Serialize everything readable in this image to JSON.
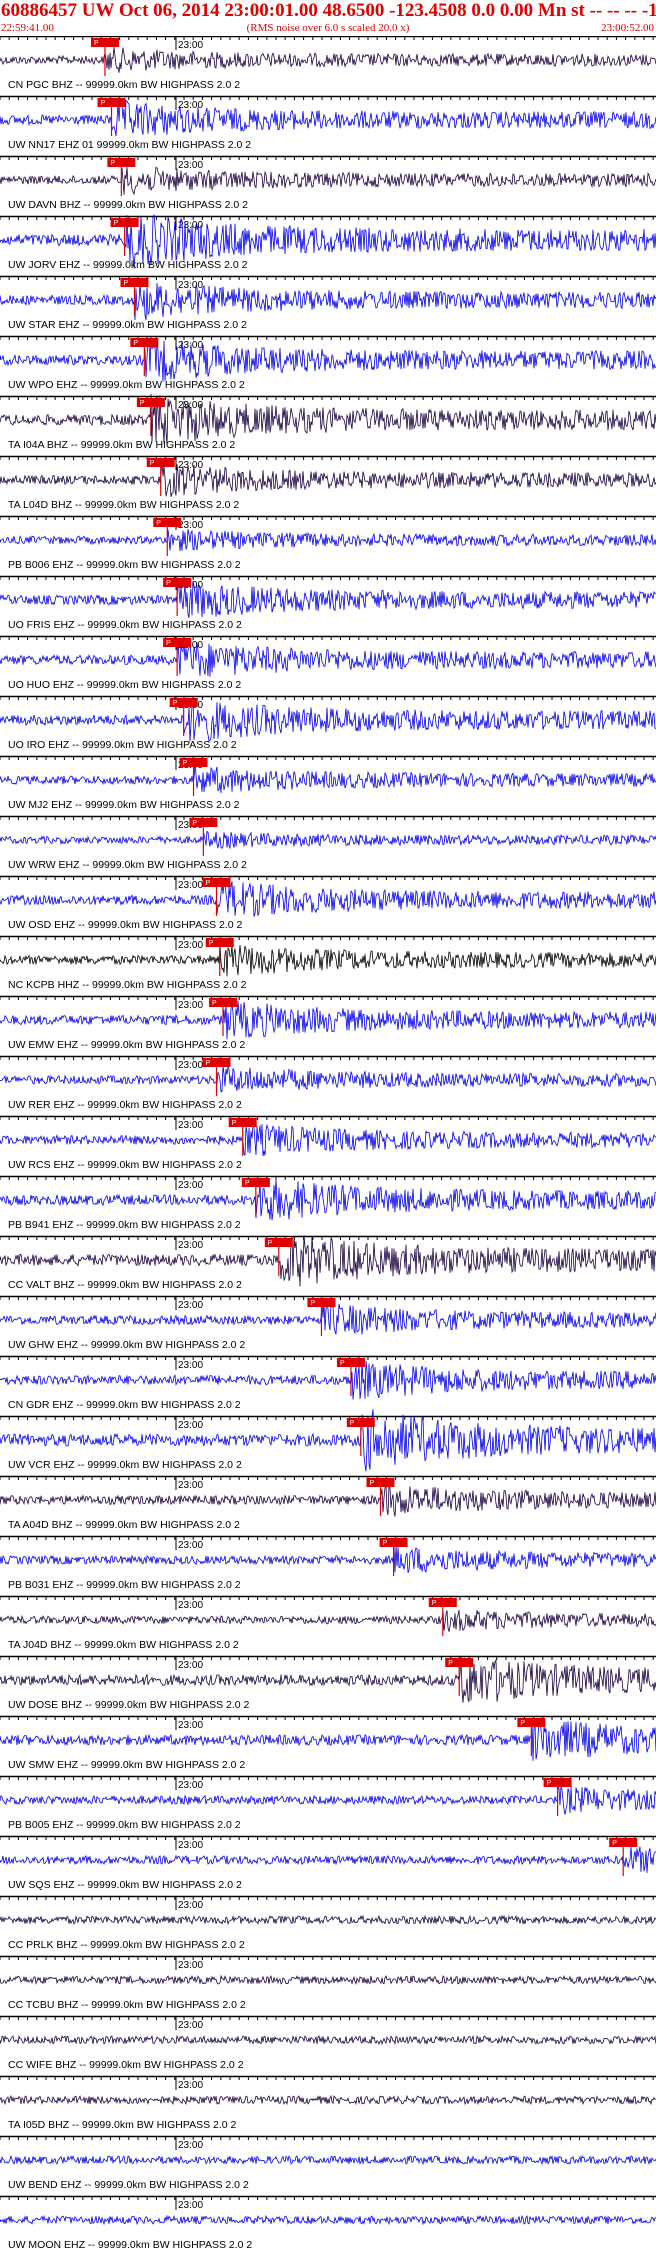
{
  "header": {
    "title": "60886457 UW Oct 06, 2014 23:00:01.00   48.6500 -123.4508  0.0 0.00 Mn st -- -- --  -1",
    "start_time": "22:59:41.00",
    "note": "(RMS noise over 6.0 s scaled 20.0 x)",
    "end_time": "23:00:52.00"
  },
  "time_mark": "23:00",
  "pick_label": "P",
  "colors": {
    "blue": "#0000ee",
    "dark": "#1a0040",
    "black": "#000000",
    "red": "#e00000"
  },
  "traces": [
    {
      "label": "CN PGC BHZ -- 99999.0km BW  HIGHPASS  2.0  2",
      "color": "dark",
      "amp": 0.35,
      "pick": 0.16
    },
    {
      "label": "UW NN17 EHZ 01 99999.0km BW  HIGHPASS  2.0  2",
      "color": "blue",
      "amp": 0.6,
      "pick": 0.17
    },
    {
      "label": "UW DAVN BHZ -- 99999.0km BW  HIGHPASS  2.0  2",
      "color": "dark",
      "amp": 0.4,
      "pick": 0.185
    },
    {
      "label": "UW JORV EHZ -- 99999.0km BW  HIGHPASS  2.0  2",
      "color": "blue",
      "amp": 0.9,
      "pick": 0.19
    },
    {
      "label": "UW STAR EHZ -- 99999.0km BW  HIGHPASS  2.0  2",
      "color": "blue",
      "amp": 0.6,
      "pick": 0.205
    },
    {
      "label": "UW WPO EHZ -- 99999.0km BW  HIGHPASS  2.0  2",
      "color": "blue",
      "amp": 0.7,
      "pick": 0.22
    },
    {
      "label": "TA I04A BHZ -- 99999.0km BW  HIGHPASS  2.0  2",
      "color": "dark",
      "amp": 0.8,
      "pick": 0.23
    },
    {
      "label": "TA L04D BHZ -- 99999.0km BW  HIGHPASS  2.0  2",
      "color": "dark",
      "amp": 0.5,
      "pick": 0.245
    },
    {
      "label": "PB B006 EHZ -- 99999.0km BW  HIGHPASS  2.0  2",
      "color": "blue",
      "amp": 0.3,
      "pick": 0.255
    },
    {
      "label": "UO FRIS EHZ -- 99999.0km BW  HIGHPASS  2.0  2",
      "color": "blue",
      "amp": 0.6,
      "pick": 0.27
    },
    {
      "label": "UO HUO EHZ -- 99999.0km BW  HIGHPASS  2.0  2",
      "color": "blue",
      "amp": 0.6,
      "pick": 0.27
    },
    {
      "label": "UO IRO EHZ -- 99999.0km BW  HIGHPASS  2.0  2",
      "color": "blue",
      "amp": 0.7,
      "pick": 0.28
    },
    {
      "label": "UW MJ2 EHZ -- 99999.0km BW  HIGHPASS  2.0  2",
      "color": "blue",
      "amp": 0.4,
      "pick": 0.295
    },
    {
      "label": "UW WRW EHZ -- 99999.0km BW  HIGHPASS  2.0  2",
      "color": "blue",
      "amp": 0.2,
      "pick": 0.31
    },
    {
      "label": "UW OSD EHZ -- 99999.0km BW  HIGHPASS  2.0  2",
      "color": "blue",
      "amp": 0.6,
      "pick": 0.33
    },
    {
      "label": "NC KCPB HHZ -- 99999.0km BW  HIGHPASS  2.0  2",
      "color": "black",
      "amp": 0.5,
      "pick": 0.335
    },
    {
      "label": "UW EMW EHZ -- 99999.0km BW  HIGHPASS  2.0  2",
      "color": "blue",
      "amp": 0.6,
      "pick": 0.34
    },
    {
      "label": "UW RER EHZ -- 99999.0km BW  HIGHPASS  2.0  2",
      "color": "blue",
      "amp": 0.4,
      "pick": 0.33
    },
    {
      "label": "UW RCS EHZ -- 99999.0km BW  HIGHPASS  2.0  2",
      "color": "blue",
      "amp": 0.5,
      "pick": 0.37
    },
    {
      "label": "PB B941 EHZ -- 99999.0km BW  HIGHPASS  2.0  2",
      "color": "blue",
      "amp": 0.7,
      "pick": 0.39
    },
    {
      "label": "CC VALT BHZ -- 99999.0km BW  HIGHPASS  2.0  2",
      "color": "dark",
      "amp": 0.9,
      "pick": 0.425
    },
    {
      "label": "UW GHW EHZ -- 99999.0km BW  HIGHPASS  2.0  2",
      "color": "blue",
      "amp": 0.5,
      "pick": 0.49
    },
    {
      "label": "CN GDR EHZ -- 99999.0km BW  HIGHPASS  2.0  2",
      "color": "blue",
      "amp": 0.6,
      "pick": 0.535
    },
    {
      "label": "UW VCR EHZ -- 99999.0km BW  HIGHPASS  2.0  2",
      "color": "blue",
      "amp": 1.0,
      "pick": 0.55
    },
    {
      "label": "TA A04D BHZ -- 99999.0km BW  HIGHPASS  2.0  2",
      "color": "dark",
      "amp": 0.5,
      "pick": 0.58
    },
    {
      "label": "PB B031 EHZ -- 99999.0km BW  HIGHPASS  2.0  2",
      "color": "blue",
      "amp": 0.4,
      "pick": 0.6
    },
    {
      "label": "TA J04D BHZ -- 99999.0km BW  HIGHPASS  2.0  2",
      "color": "dark",
      "amp": 0.3,
      "pick": 0.675
    },
    {
      "label": "UW DOSE BHZ -- 99999.0km BW  HIGHPASS  2.0  2",
      "color": "dark",
      "amp": 0.8,
      "pick": 0.7
    },
    {
      "label": "UW SMW EHZ -- 99999.0km BW  HIGHPASS  2.0  2",
      "color": "blue",
      "amp": 0.7,
      "pick": 0.81
    },
    {
      "label": "PB B005 EHZ -- 99999.0km BW  HIGHPASS  2.0  2",
      "color": "blue",
      "amp": 0.4,
      "pick": 0.85
    },
    {
      "label": "UW SQS EHZ -- 99999.0km BW  HIGHPASS  2.0  2",
      "color": "blue",
      "amp": 0.4,
      "pick": 0.95
    },
    {
      "label": "CC PRLK BHZ -- 99999.0km BW  HIGHPASS  2.0  2",
      "color": "dark",
      "amp": 0.3,
      "pick": null
    },
    {
      "label": "CC TCBU BHZ -- 99999.0km BW  HIGHPASS  2.0  2",
      "color": "dark",
      "amp": 0.3,
      "pick": null
    },
    {
      "label": "CC WIFE BHZ -- 99999.0km BW  HIGHPASS  2.0  2",
      "color": "dark",
      "amp": 0.3,
      "pick": null
    },
    {
      "label": "TA I05D BHZ -- 99999.0km BW  HIGHPASS  2.0  2",
      "color": "dark",
      "amp": 0.3,
      "pick": null
    },
    {
      "label": "UW BEND EHZ -- 99999.0km BW  HIGHPASS  2.0  2",
      "color": "blue",
      "amp": 0.3,
      "pick": null
    },
    {
      "label": "UW MOON EHZ -- 99999.0km BW  HIGHPASS  2.0  2",
      "color": "blue",
      "amp": 0.3,
      "pick": null
    }
  ]
}
